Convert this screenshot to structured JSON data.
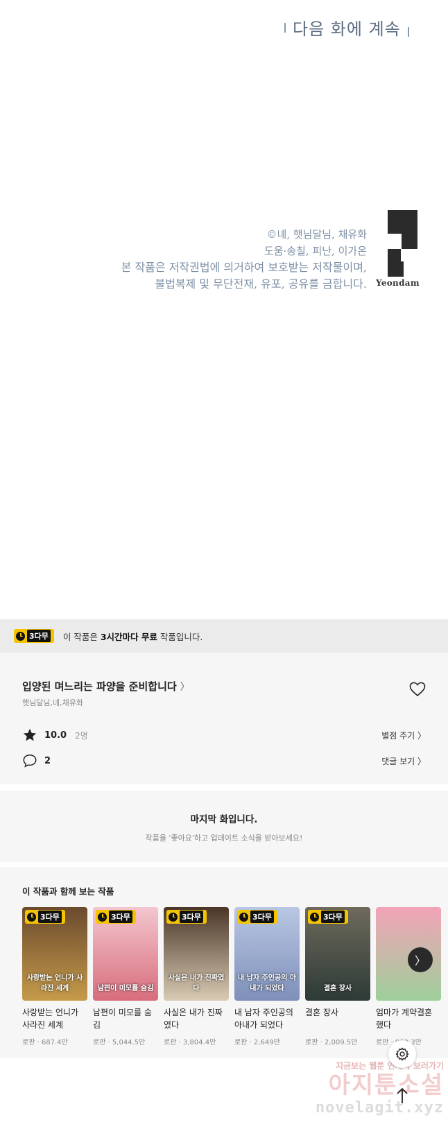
{
  "panel": {
    "continue_text": "다음 화에 계속",
    "credit_line1": "©녜, 햇님달님, 채유화",
    "credit_line2": "도움·송칠, 피난, 이가온",
    "copyright_line1": "본 작품은 저작권법에 의거하여 보호받는 저작물이며,",
    "copyright_line2": "불법복제 및 무단전재, 유포, 공유를 금합니다.",
    "publisher": "Yeondam"
  },
  "free_notice": {
    "badge": "3다무",
    "prefix": "이 작품은 ",
    "emphasis": "3시간마다 무료",
    "suffix": " 작품입니다."
  },
  "work": {
    "title": "입양된 며느리는 파양을 준비합니다",
    "authors": "햇님달님,녜,채유화",
    "rating": "10.0",
    "rating_count": "2명",
    "rate_action": "별점 주기 〉",
    "comments": "2",
    "comments_action": "댓글 보기 〉"
  },
  "last_episode": {
    "heading": "마지막 화입니다.",
    "subtext": "작품을 '좋아요'하고 업데이트 소식을 받아보세요!"
  },
  "recommendations": {
    "heading": "이 작품과 함께 보는 작품",
    "items": [
      {
        "title": "사랑받는 언니가 사라진 세계",
        "meta": "로판 · 687.4만",
        "badge": "3다무",
        "cover_text": "사랑받는 언니가 사라진 세계",
        "color_top": "#6b4a2e",
        "color_bottom": "#c59b4a"
      },
      {
        "title": "남편이 미모를 숨김",
        "meta": "로판 · 5,044.5만",
        "badge": "3다무",
        "cover_text": "남편이 미모를 숨김",
        "color_top": "#f3c6cf",
        "color_bottom": "#d86d7c"
      },
      {
        "title": "사실은 내가 진짜였다",
        "meta": "로판 · 3,804.4만",
        "badge": "3다무",
        "cover_text": "사실은 내가 진짜였다",
        "color_top": "#4a3628",
        "color_bottom": "#d9cbb4"
      },
      {
        "title": "내 남자 주인공의 아내가 되었다",
        "meta": "로판 · 2,649만",
        "badge": "3다무",
        "cover_text": "내 남자 주인공의 아내가 되었다",
        "color_top": "#b9c7e3",
        "color_bottom": "#7e8fb9"
      },
      {
        "title": "결혼 장사",
        "meta": "로판 · 2,009.5만",
        "badge": "3다무",
        "cover_text": "결혼 장사",
        "color_top": "#6e6a5c",
        "color_bottom": "#2d3a36"
      },
      {
        "title": "엄마가 계약결혼 했다",
        "meta": "로판 · 999.3만",
        "badge": "",
        "cover_text": "",
        "color_top": "#f3a3b8",
        "color_bottom": "#9dcf9a"
      }
    ]
  },
  "watermark": {
    "line1": "지금보는 웹툰 연재속 보러가기",
    "line2": "아지툰소설",
    "line3": "novelagit.xyz"
  }
}
